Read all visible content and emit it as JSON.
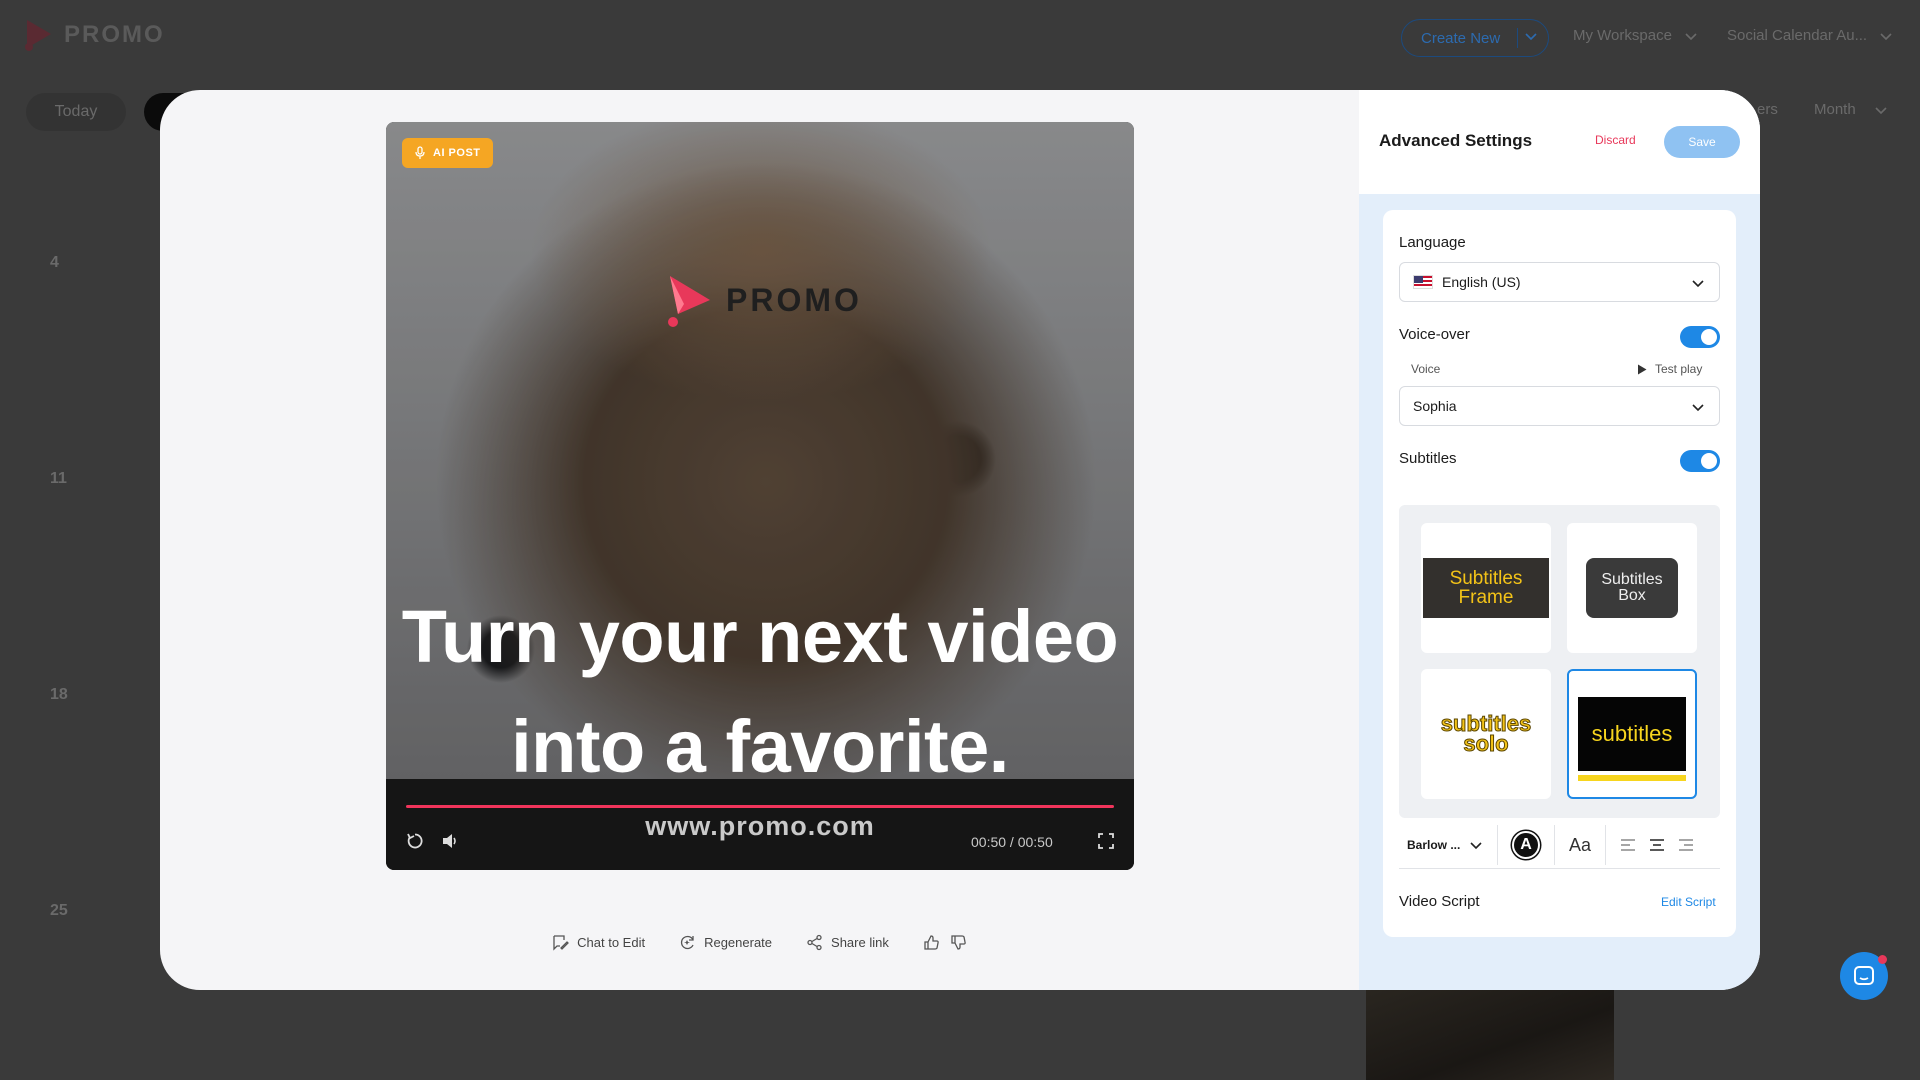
{
  "app": {
    "logo_text": "PROMO",
    "create_new": "Create New",
    "menu_workspace": "My Workspace",
    "menu_calendar": "Social Calendar Au...",
    "today": "Today",
    "filters_partial": "ers",
    "month": "Month",
    "day_numbers": [
      "4",
      "11",
      "18",
      "25"
    ]
  },
  "video": {
    "badge": "AI POST",
    "logo_text": "PROMO",
    "caption_line1": "Turn your next video",
    "caption_line2": "into a favorite.",
    "url": "www.promo.com",
    "time": "00:50 / 00:50",
    "progress": 1.0
  },
  "actions": {
    "chat": "Chat to Edit",
    "regenerate": "Regenerate",
    "share": "Share link"
  },
  "settings": {
    "title": "Advanced Settings",
    "discard": "Discard",
    "save": "Save",
    "language_label": "Language",
    "language_value": "English (US)",
    "voiceover_label": "Voice-over",
    "voiceover_on": true,
    "voice_label": "Voice",
    "test_play": "Test play",
    "voice_value": "Sophia",
    "subtitles_label": "Subtitles",
    "subtitles_on": true,
    "styles": {
      "frame_l1": "Subtitles",
      "frame_l2": "Frame",
      "box_l1": "Subtitles",
      "box_l2": "Box",
      "solo_l1": "subtitles",
      "solo_l2": "solo",
      "selected": "subtitles"
    },
    "font_name": "Barlow ...",
    "color_letter": "A",
    "case_label": "Aa",
    "script_label": "Video Script",
    "edit_script": "Edit Script"
  },
  "colors": {
    "accent": "#1e88e5",
    "brand": "#f0345b",
    "badge": "#f5a623",
    "subtitle_yellow": "#f3c318"
  }
}
